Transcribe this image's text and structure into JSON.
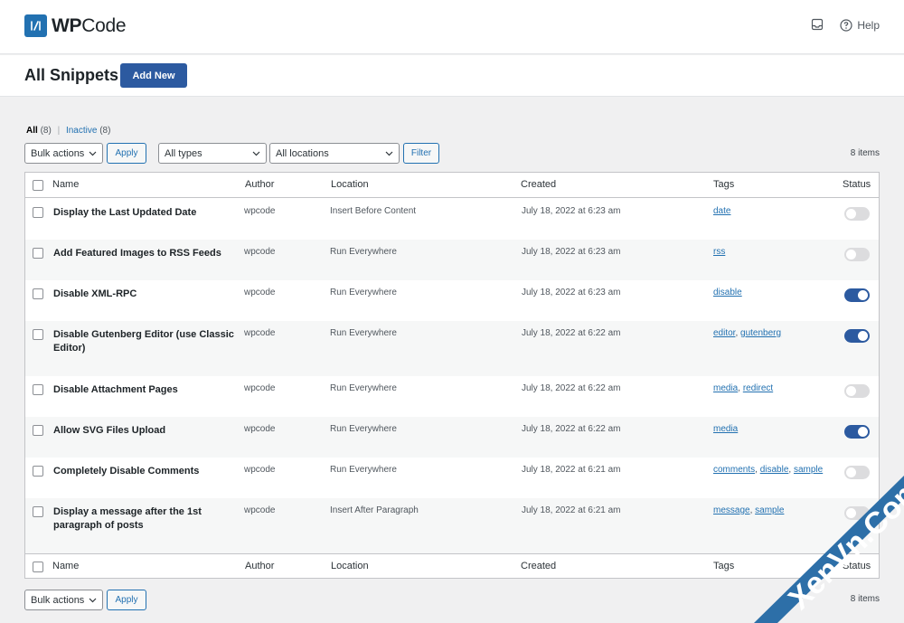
{
  "brand": {
    "wp": "WP",
    "code": "Code"
  },
  "header": {
    "help_label": "Help"
  },
  "page": {
    "title": "All Snippets",
    "add_new_label": "Add New"
  },
  "views": {
    "all_label": "All",
    "all_count": "(8)",
    "separator": "|",
    "inactive_label": "Inactive",
    "inactive_count": "(8)"
  },
  "top_controls": {
    "bulk_actions": "Bulk actions",
    "apply_label": "Apply",
    "types": "All types",
    "locations": "All locations",
    "filter_label": "Filter",
    "items_count": "8 items"
  },
  "bottom_controls": {
    "bulk_actions": "Bulk actions",
    "apply_label": "Apply",
    "items_count": "8 items"
  },
  "columns": {
    "name": "Name",
    "author": "Author",
    "location": "Location",
    "created": "Created",
    "tags": "Tags",
    "status": "Status"
  },
  "footer_columns": {
    "name": "Name",
    "author": "Author",
    "location": "Location",
    "created": "Created",
    "tags": "Tags",
    "status": "Status"
  },
  "snippets": [
    {
      "name": "Display the Last Updated Date",
      "author": "wpcode",
      "location": "Insert Before Content",
      "created": "July 18, 2022 at 6:23 am",
      "tags": [
        "date"
      ],
      "active": false
    },
    {
      "name": "Add Featured Images to RSS Feeds",
      "author": "wpcode",
      "location": "Run Everywhere",
      "created": "July 18, 2022 at 6:23 am",
      "tags": [
        "rss"
      ],
      "active": false
    },
    {
      "name": "Disable XML-RPC",
      "author": "wpcode",
      "location": "Run Everywhere",
      "created": "July 18, 2022 at 6:23 am",
      "tags": [
        "disable"
      ],
      "active": true
    },
    {
      "name": "Disable Gutenberg Editor (use Classic Editor)",
      "author": "wpcode",
      "location": "Run Everywhere",
      "created": "July 18, 2022 at 6:22 am",
      "tags": [
        "editor",
        "gutenberg"
      ],
      "active": true
    },
    {
      "name": "Disable Attachment Pages",
      "author": "wpcode",
      "location": "Run Everywhere",
      "created": "July 18, 2022 at 6:22 am",
      "tags": [
        "media",
        "redirect"
      ],
      "active": false
    },
    {
      "name": "Allow SVG Files Upload",
      "author": "wpcode",
      "location": "Run Everywhere",
      "created": "July 18, 2022 at 6:22 am",
      "tags": [
        "media"
      ],
      "active": true
    },
    {
      "name": "Completely Disable Comments",
      "author": "wpcode",
      "location": "Run Everywhere",
      "created": "July 18, 2022 at 6:21 am",
      "tags": [
        "comments",
        "disable",
        "sample"
      ],
      "active": false
    },
    {
      "name": "Display a message after the 1st paragraph of posts",
      "author": "wpcode",
      "location": "Insert After Paragraph",
      "created": "July 18, 2022 at 6:21 am",
      "tags": [
        "message",
        "sample"
      ],
      "active": false
    }
  ],
  "watermark": {
    "text": "XenVn.Com"
  },
  "colors": {
    "accent": "#2c5aa0",
    "link": "#2271b1",
    "toggle_off": "#dcdcde"
  }
}
